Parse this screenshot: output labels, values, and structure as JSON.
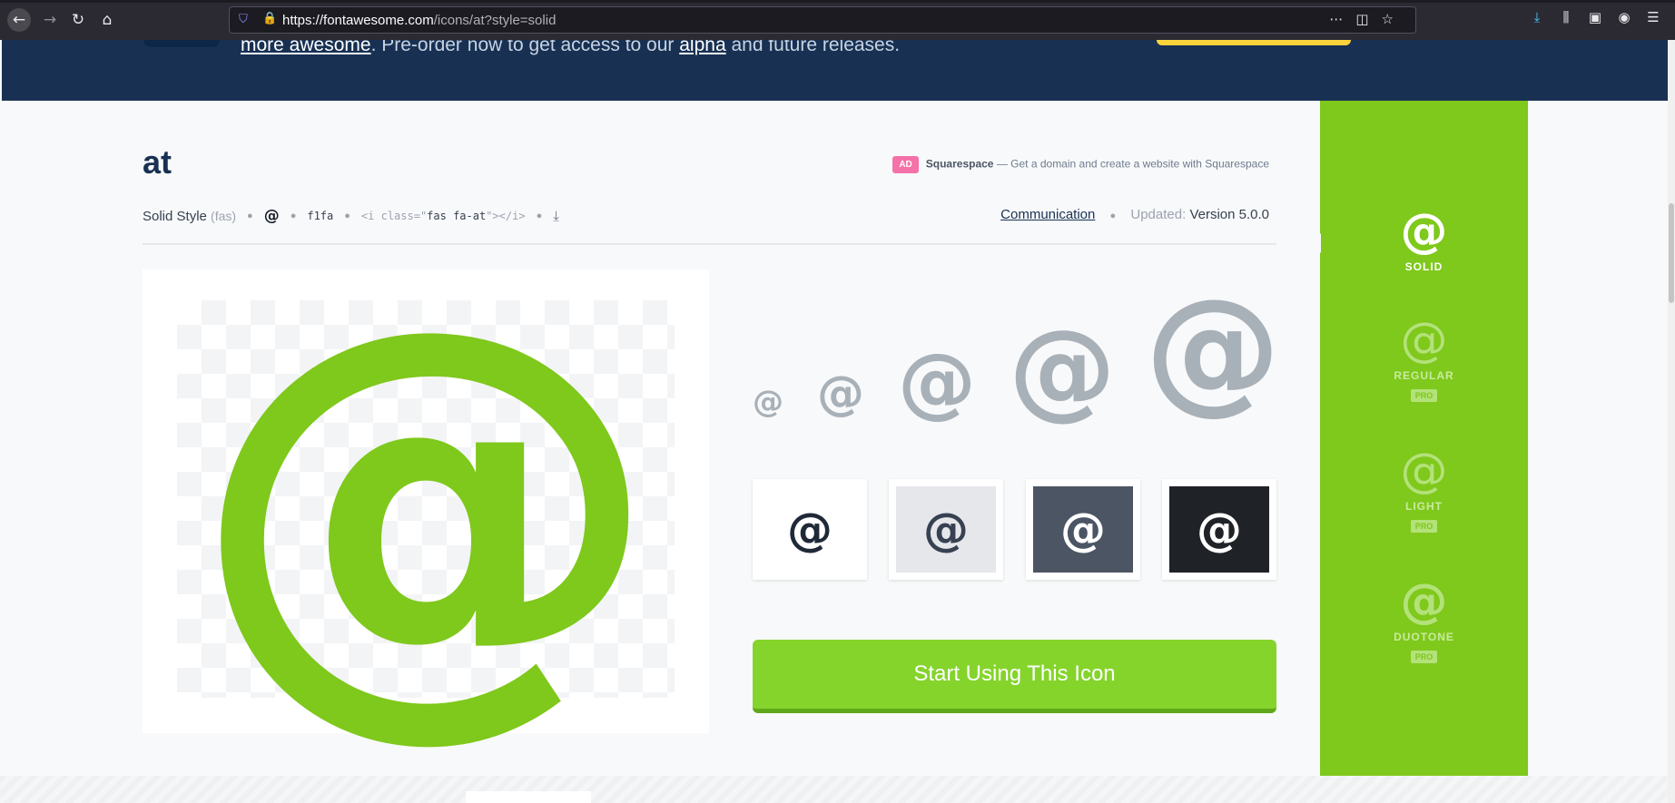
{
  "browser": {
    "url_host": "https://fontawesome.com",
    "url_path": "/icons/at?style=solid",
    "icons": [
      "back-icon",
      "forward-icon",
      "reload-icon",
      "home-icon",
      "shield-icon",
      "lock-icon",
      "more-icon",
      "pocket-icon",
      "bookmark-star-icon",
      "download-icon",
      "library-icon",
      "sidebar-icon",
      "account-icon",
      "menu-icon"
    ]
  },
  "banner": {
    "link1": "more awesome",
    "text_mid": ". Pre-order now to get access to our ",
    "link2": "alpha",
    "text_end": " and future releases."
  },
  "icon": {
    "name": "at",
    "glyph": "@",
    "style_label": "Solid Style",
    "style_prefix": "(fas)",
    "unicode": "f1fa",
    "html_open": "<i class=\"",
    "html_class": "fas fa-at",
    "html_close": "\"></i>",
    "category": "Communication",
    "updated_label": "Updated:",
    "version": "Version 5.0.0"
  },
  "ad": {
    "badge": "AD",
    "brand": "Squarespace",
    "dash": " — ",
    "text": "Get a domain and create a website with Squarespace"
  },
  "swatches": [
    {
      "bg": "#ffffff",
      "fg": "#1f2937"
    },
    {
      "bg": "#e5e7eb",
      "fg": "#374151"
    },
    {
      "bg": "#4b5563",
      "fg": "#ffffff"
    },
    {
      "bg": "#1f2227",
      "fg": "#ffffff"
    }
  ],
  "cta": {
    "label": "Start Using This Icon"
  },
  "styles": [
    {
      "label": "SOLID",
      "pro": ""
    },
    {
      "label": "REGULAR",
      "pro": "PRO"
    },
    {
      "label": "LIGHT",
      "pro": "PRO"
    },
    {
      "label": "DUOTONE",
      "pro": "PRO"
    }
  ],
  "colors": {
    "brand_green": "#7fc81c",
    "banner_navy": "#183153",
    "size_grey": "#a8b0b8"
  }
}
